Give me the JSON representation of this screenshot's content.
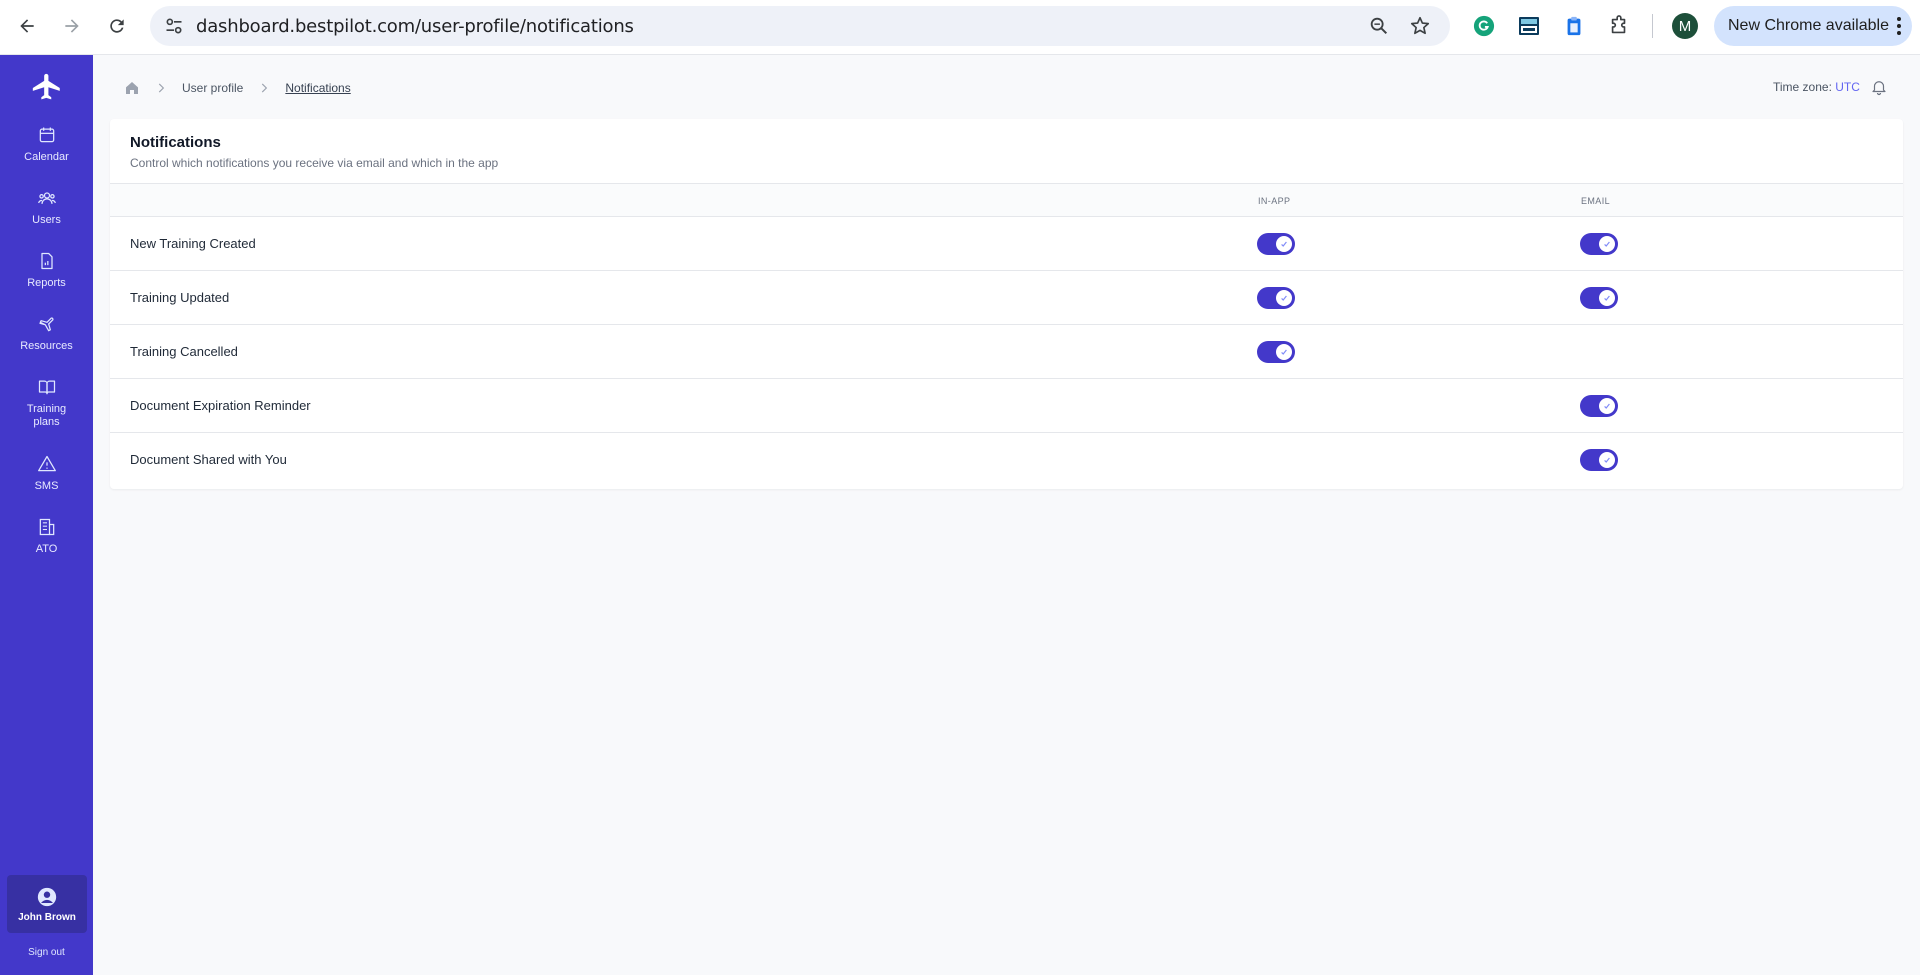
{
  "browser": {
    "url": "dashboard.bestpilot.com/user-profile/notifications",
    "update_label": "New Chrome available",
    "profile_initial": "M"
  },
  "sidebar": {
    "items": [
      {
        "label": "Calendar",
        "icon": "calendar-icon"
      },
      {
        "label": "Users",
        "icon": "users-icon"
      },
      {
        "label": "Reports",
        "icon": "report-icon"
      },
      {
        "label": "Resources",
        "icon": "plane-icon"
      },
      {
        "label": "Training plans",
        "icon": "book-icon"
      },
      {
        "label": "SMS",
        "icon": "warning-icon"
      },
      {
        "label": "ATO",
        "icon": "building-icon"
      }
    ],
    "user_name": "John Brown",
    "sign_out": "Sign out"
  },
  "breadcrumb": {
    "parent": "User profile",
    "current": "Notifications"
  },
  "timezone": {
    "label": "Time zone:",
    "value": "UTC"
  },
  "card": {
    "title": "Notifications",
    "subtitle": "Control which notifications you receive via email and which in the app",
    "col_inapp": "IN-APP",
    "col_email": "EMAIL",
    "rows": [
      {
        "label": "New Training Created",
        "inapp": true,
        "email": true
      },
      {
        "label": "Training Updated",
        "inapp": true,
        "email": true
      },
      {
        "label": "Training Cancelled",
        "inapp": true,
        "email": false
      },
      {
        "label": "Document Expiration Reminder",
        "inapp": false,
        "email": true
      },
      {
        "label": "Document Shared with You",
        "inapp": false,
        "email": true
      }
    ]
  },
  "colors": {
    "accent": "#4338ca",
    "background": "#f8f9fb"
  }
}
